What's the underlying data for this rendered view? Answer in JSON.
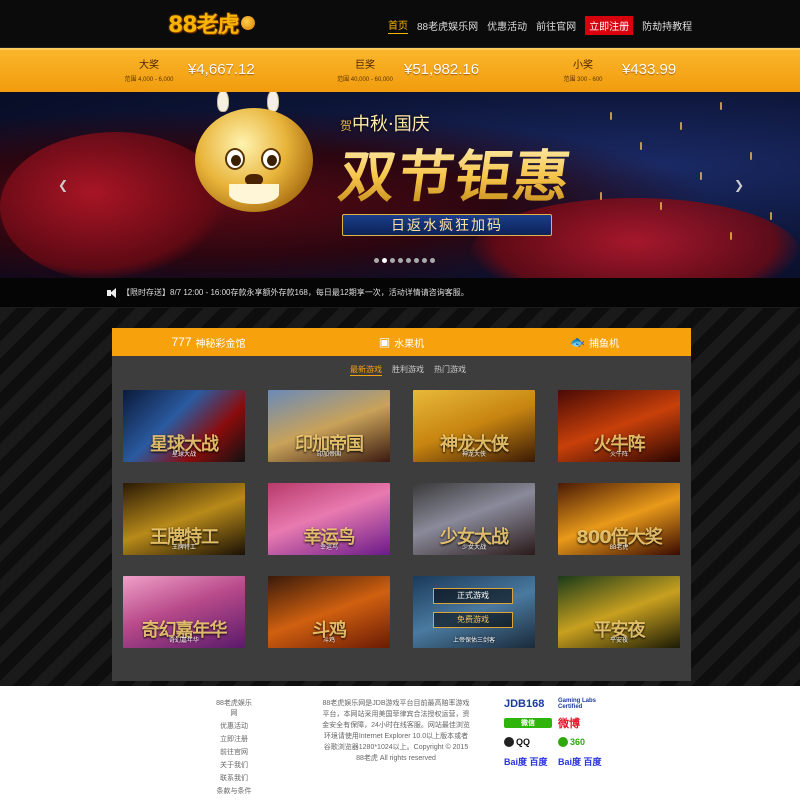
{
  "header": {
    "logo_text": "88老虎",
    "nav": [
      {
        "label": "首页",
        "active": true
      },
      {
        "label": "88老虎娱乐网",
        "active": false
      },
      {
        "label": "优惠活动",
        "active": false
      },
      {
        "label": "前往官网",
        "active": false
      },
      {
        "label": "立即注册",
        "active": false,
        "highlight": true
      },
      {
        "label": "防劫持教程",
        "active": false
      }
    ]
  },
  "jackpots": [
    {
      "name": "大奖",
      "range": "范围 4,000 - 6,000",
      "amount": "¥4,667.12"
    },
    {
      "name": "巨奖",
      "range": "范围 40,000 - 60,000",
      "amount": "¥51,982.16"
    },
    {
      "name": "小奖",
      "range": "范围 300 - 600",
      "amount": "¥433.99"
    }
  ],
  "banner": {
    "mark": "贺",
    "title_small": "中秋·国庆",
    "title_big": "双节钜惠",
    "subtitle": "日返水疯狂加码",
    "prev_icon": "chevron-left",
    "next_icon": "chevron-right",
    "dots": 8,
    "active_dot": 1
  },
  "notice": {
    "text": "【限时存送】8/7 12:00 - 16:00存款永享额外存款168，每日最12期享一次，活动详情请咨询客服。"
  },
  "game_panel": {
    "tabs": [
      {
        "icon": "777",
        "label": "神秘彩金馆"
      },
      {
        "icon": "▣",
        "label": "水果机"
      },
      {
        "icon": "🐟",
        "label": "捕鱼机"
      }
    ],
    "subtabs": [
      {
        "label": "最新游戏",
        "active": true
      },
      {
        "label": "胜利游戏",
        "active": false
      },
      {
        "label": "热门游戏",
        "active": false
      }
    ],
    "games": [
      {
        "big": "星球大战",
        "caption": "星球大战",
        "bg": "linear-gradient(135deg,#0a1a3a,#2a5aa0 40%,#8a0c0c 70%,#111)"
      },
      {
        "big": "印加帝国",
        "caption": "印加帝国",
        "bg": "linear-gradient(160deg,#6a8ab8,#c9a25a 50%,#3a1a10)"
      },
      {
        "big": "神龙大侠",
        "caption": "神龙大侠",
        "bg": "linear-gradient(160deg,#e8b93a,#c78410 50%,#3a1a05)"
      },
      {
        "big": "火牛阵",
        "caption": "火牛阵",
        "bg": "linear-gradient(160deg,#4a0a05,#c8400a 50%,#2a0502)"
      },
      {
        "big": "王牌特工",
        "caption": "王牌特工",
        "bg": "linear-gradient(160deg,#2a1a05,#b88a1a 50%,#1a1005)"
      },
      {
        "big": "幸运鸟",
        "caption": "幸运鸟",
        "bg": "linear-gradient(160deg,#b83a6a,#e87ab0 45%,#6a1a8a)"
      },
      {
        "big": "少女大战",
        "caption": "少女大战",
        "bg": "linear-gradient(160deg,#3a3a3a,#8a8a9a 45%,#2a1a1a)"
      },
      {
        "big": "800倍大奖",
        "caption": "88老虎",
        "bg": "linear-gradient(160deg,#4a1a05,#e89a1a 50%,#3a0a02)"
      },
      {
        "big": "奇幻嘉年华",
        "caption": "奇幻嘉年华",
        "bg": "linear-gradient(160deg,#f0a0c8,#b84a8a 45%,#5a1a6a)"
      },
      {
        "big": "斗鸡",
        "caption": "斗鸡",
        "bg": "linear-gradient(160deg,#3a1a0a,#d06010 50%,#6a1a05)"
      },
      {
        "big": "",
        "caption": "上帝保佑三剑客",
        "bg": "linear-gradient(160deg,#1a3a5a,#4a7aa0 50%,#1a2a3a)",
        "buttons": [
          "正式游戏",
          "免费游戏"
        ]
      },
      {
        "big": "平安夜",
        "caption": "平安夜",
        "bg": "linear-gradient(160deg,#1a3a1a,#c8a020 50%,#1a1a05)"
      }
    ]
  },
  "footer": {
    "links": [
      "88老虎娱乐网",
      "优惠活动",
      "立即注册",
      "前往官网",
      "关于我们",
      "联系我们",
      "条款与条件"
    ],
    "description": "88老虎娱乐网是JDB游戏平台目前最高赔率游戏平台，本网站采用美国菲律宾合法授权运营，资金安全有保障，24小时在线客服。网站最佳浏览环境请使用Internet Explorer 10.0以上版本或者谷歌浏览器1280*1024以上。Copyright © 2015 88老虎 All rights reserved",
    "partners": [
      "JDB168",
      "Gaming Labs Certified",
      "微信",
      "微博",
      "QQ",
      "360",
      "Bai度 百度",
      "Bai度 百度"
    ]
  },
  "colors": {
    "accent": "#f7a20c",
    "gold": "#f7b500",
    "register": "#d9000d",
    "panel": "#3d3d3d"
  }
}
